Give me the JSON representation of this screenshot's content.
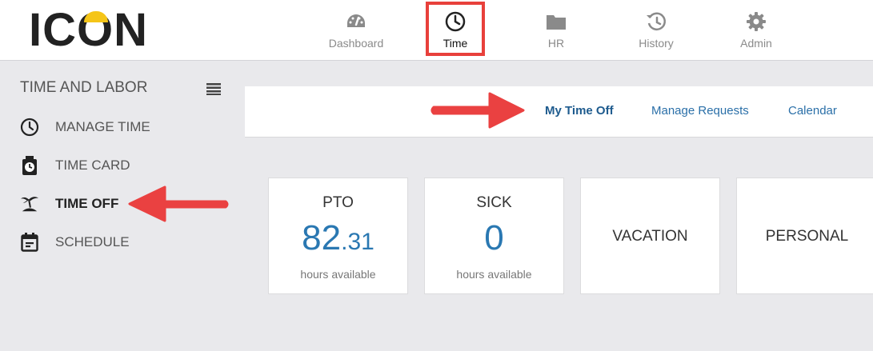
{
  "brand": {
    "logo_text_left": "IC",
    "logo_text_o": "O",
    "logo_text_right": "N"
  },
  "topnav": {
    "items": [
      {
        "label": "Dashboard",
        "icon": "speedometer-icon"
      },
      {
        "label": "Time",
        "icon": "clock-icon",
        "active": true
      },
      {
        "label": "HR",
        "icon": "folder-icon"
      },
      {
        "label": "History",
        "icon": "history-icon"
      },
      {
        "label": "Admin",
        "icon": "gear-icon"
      }
    ]
  },
  "sidebar": {
    "title": "TIME AND LABOR",
    "items": [
      {
        "label": "MANAGE TIME",
        "icon": "clock-icon"
      },
      {
        "label": "TIME CARD",
        "icon": "time-card-icon"
      },
      {
        "label": "TIME OFF",
        "icon": "island-icon",
        "active": true
      },
      {
        "label": "SCHEDULE",
        "icon": "calendar-icon"
      }
    ]
  },
  "subnav": {
    "links": [
      {
        "label": "My Time Off",
        "active": true
      },
      {
        "label": "Manage Requests"
      },
      {
        "label": "Calendar"
      }
    ]
  },
  "balances": [
    {
      "name": "PTO",
      "value_int": "82",
      "value_dec": ".31",
      "caption": "hours available"
    },
    {
      "name": "SICK",
      "value_int": "0",
      "value_dec": "",
      "caption": "hours available"
    },
    {
      "name": "VACATION"
    },
    {
      "name": "PERSONAL"
    }
  ],
  "colors": {
    "accent": "#2a78b2",
    "highlight": "#e8403b",
    "logo_arc": "#f5c518"
  }
}
